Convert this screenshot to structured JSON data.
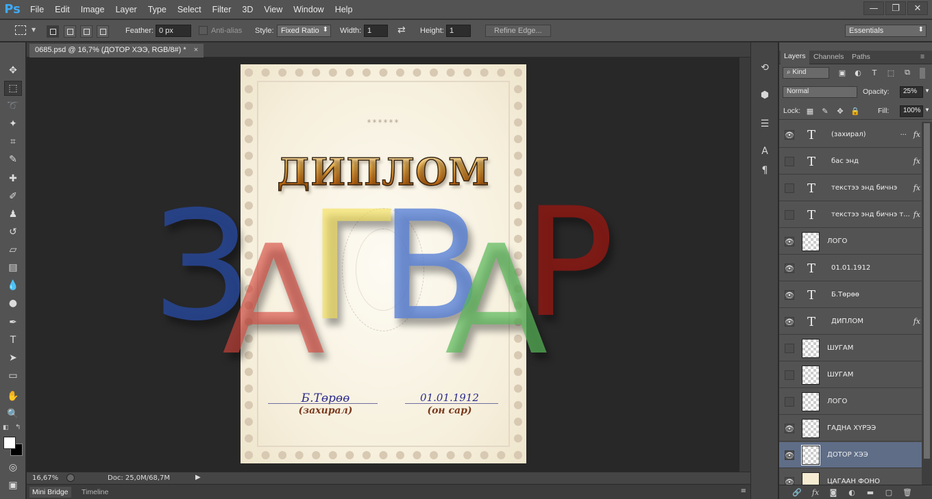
{
  "app": {
    "logo": "Ps",
    "menu": [
      "File",
      "Edit",
      "Image",
      "Layer",
      "Type",
      "Select",
      "Filter",
      "3D",
      "View",
      "Window",
      "Help"
    ],
    "window_controls": [
      "—",
      "❐",
      "✕"
    ]
  },
  "options": {
    "feather_label": "Feather:",
    "feather_value": "0 px",
    "antialias_label": "Anti-alias",
    "style_label": "Style:",
    "style_value": "Fixed Ratio",
    "width_label": "Width:",
    "width_value": "1",
    "height_label": "Height:",
    "height_value": "1",
    "refine_edge": "Refine Edge...",
    "workspace": "Essentials"
  },
  "document": {
    "tab_title": "0685.psd @ 16,7% (ДОТОР ХЭЭ, RGB/8#) *",
    "tab_close": "×",
    "zoom": "16,67%",
    "doc_info": "Doc: 25,0M/68,7M",
    "bottom_tabs": [
      "Mini Bridge",
      "Timeline"
    ],
    "page": {
      "stars": "******",
      "title": "ДИПЛОМ",
      "signer_name": "Б.Төрөө",
      "signer_role": "(захирал)",
      "date": "01.01.1912",
      "date_label": "(он сар)"
    },
    "watermark": [
      "З",
      "А",
      "Г",
      "В",
      "А",
      "Р"
    ]
  },
  "layers_panel": {
    "tabs": [
      "Layers",
      "Channels",
      "Paths"
    ],
    "filter_kind": "Kind",
    "blend_mode": "Normal",
    "opacity_label": "Opacity:",
    "opacity_value": "25%",
    "lock_label": "Lock:",
    "fill_label": "Fill:",
    "fill_value": "100%",
    "layers": [
      {
        "name": "(захирал)",
        "type": "text",
        "visible": true,
        "fx": true,
        "ellipsis": "..."
      },
      {
        "name": "бас энд",
        "type": "text",
        "visible": false,
        "fx": true
      },
      {
        "name": "текстээ энд бичнэ",
        "type": "text",
        "visible": false,
        "fx": true
      },
      {
        "name": "текстээ энд бичнэ т...",
        "type": "text",
        "visible": false,
        "fx": true
      },
      {
        "name": "ЛОГО",
        "type": "pixel",
        "visible": true,
        "fx": false
      },
      {
        "name": "01.01.1912",
        "type": "text",
        "visible": true,
        "fx": false
      },
      {
        "name": "Б.Төрөө",
        "type": "text",
        "visible": true,
        "fx": false
      },
      {
        "name": "ДИПЛОМ",
        "type": "text",
        "visible": true,
        "fx": true
      },
      {
        "name": "ШУГАМ",
        "type": "pixel",
        "visible": false,
        "fx": false
      },
      {
        "name": "ШУГАМ",
        "type": "pixel",
        "visible": false,
        "fx": false
      },
      {
        "name": "ЛОГО",
        "type": "pixel",
        "visible": false,
        "fx": false
      },
      {
        "name": "ГАДНА ХҮРЭЭ",
        "type": "pixel",
        "visible": true,
        "fx": false
      },
      {
        "name": "ДОТОР ХЭЭ",
        "type": "pixel",
        "visible": true,
        "fx": false,
        "selected": true
      },
      {
        "name": "ЦАГААН ФОНО",
        "type": "cream",
        "visible": true,
        "fx": false
      }
    ]
  }
}
